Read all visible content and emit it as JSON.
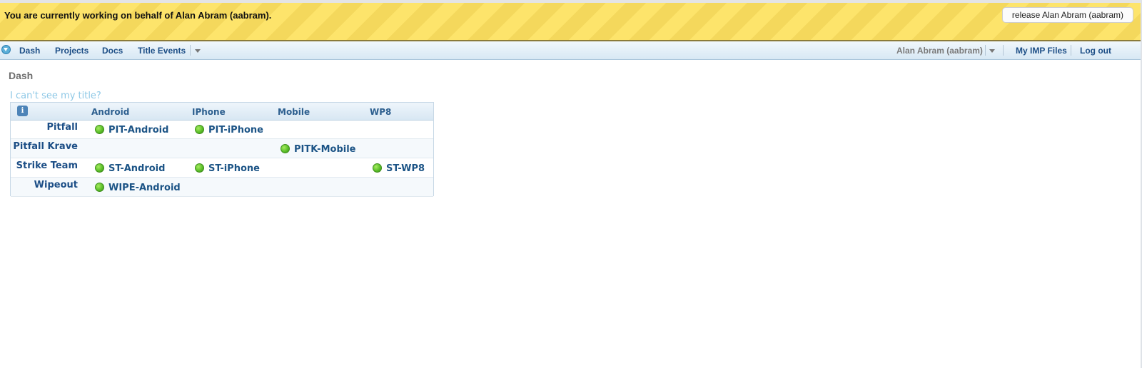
{
  "banner": {
    "text": "You are currently working on behalf of Alan Abram (aabram).",
    "release_label": "release Alan Abram (aabram)",
    "color": "#fde46b"
  },
  "nav": {
    "items": [
      {
        "label": "Dash"
      },
      {
        "label": "Projects"
      },
      {
        "label": "Docs"
      },
      {
        "label": "Title Events"
      }
    ],
    "user": "Alan Abram (aabram)",
    "imp_files": "My IMP Files",
    "logout": "Log out"
  },
  "page": {
    "title": "Dash",
    "help_link": "I can't see my title?"
  },
  "grid": {
    "info_icon": "info-icon",
    "columns": [
      "Android",
      "IPhone",
      "Mobile",
      "WP8"
    ],
    "rows": [
      {
        "title": "Pitfall",
        "android": "PIT-Android",
        "iphone": "PIT-iPhone"
      },
      {
        "title": "Pitfall Krave",
        "mobile": "PITK-Mobile"
      },
      {
        "title": "Strike Team",
        "android": "ST-Android",
        "iphone": "ST-iPhone",
        "wp8": "ST-WP8"
      },
      {
        "title": "Wipeout",
        "android": "WIPE-Android"
      }
    ],
    "status_color": "#5cbf2a"
  }
}
